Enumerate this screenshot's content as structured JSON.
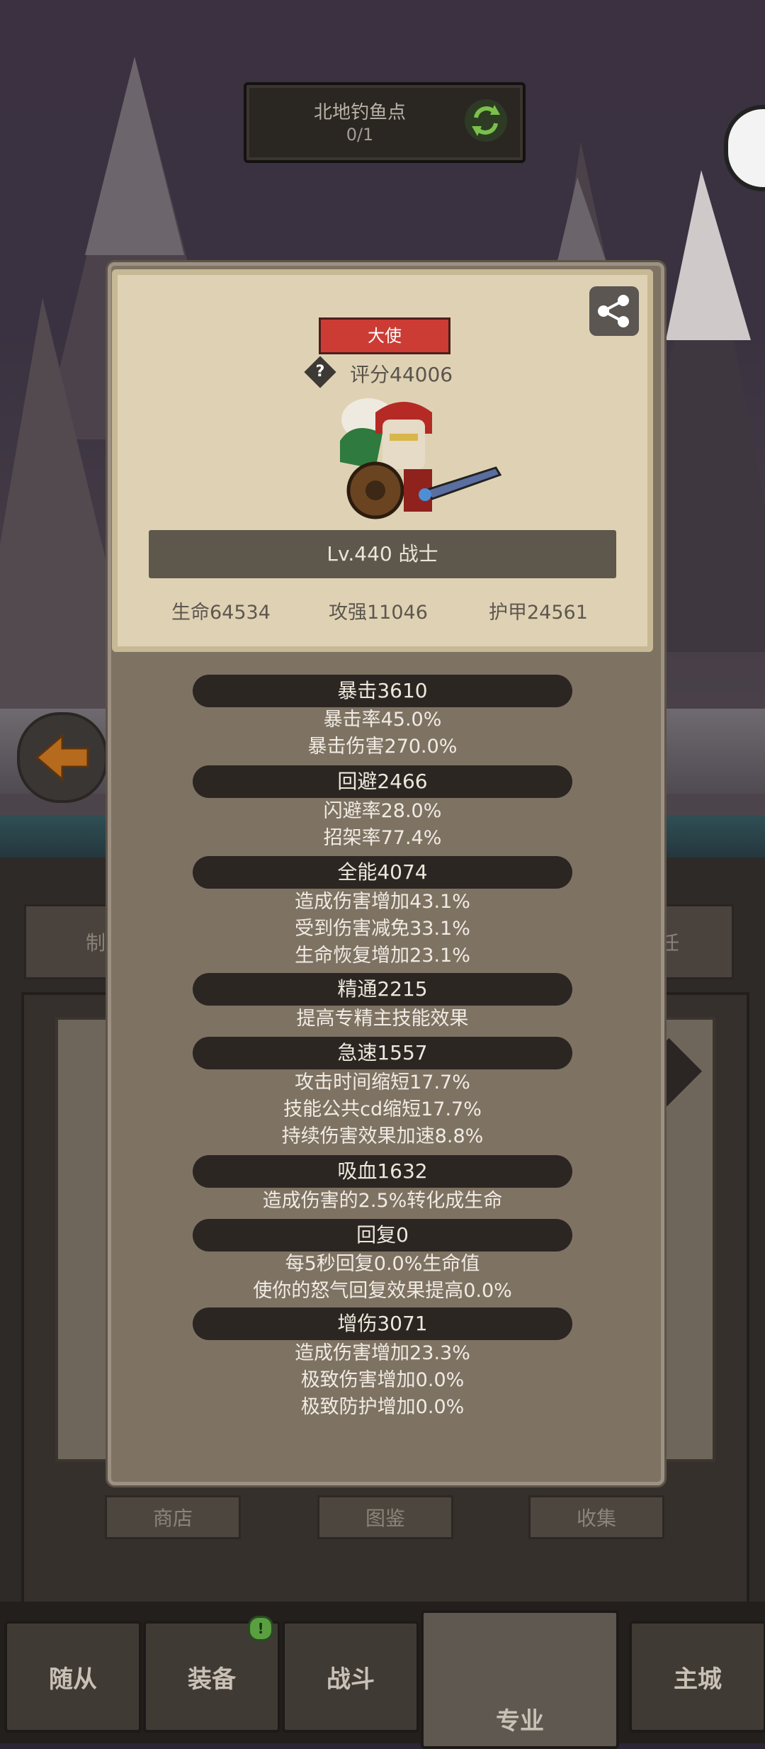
{
  "location": {
    "name": "北地钓鱼点",
    "count": "0/1"
  },
  "character": {
    "rank": "大使",
    "score": "评分44006",
    "level": "Lv.440 战士",
    "base_stats": [
      "生命64534",
      "攻强11046",
      "护甲24561"
    ]
  },
  "stats": [
    {
      "title": "暴击3610",
      "details": [
        "暴击率45.0%",
        "暴击伤害270.0%"
      ]
    },
    {
      "title": "回避2466",
      "details": [
        "闪避率28.0%",
        "招架率77.4%"
      ]
    },
    {
      "title": "全能4074",
      "details": [
        "造成伤害增加43.1%",
        "受到伤害减免33.1%",
        "生命恢复增加23.1%"
      ]
    },
    {
      "title": "精通2215",
      "details": [
        "提高专精主技能效果"
      ]
    },
    {
      "title": "急速1557",
      "details": [
        "攻击时间缩短17.7%",
        "技能公共cd缩短17.7%",
        "持续伤害效果加速8.8%"
      ]
    },
    {
      "title": "吸血1632",
      "details": [
        "造成伤害的2.5%转化成生命"
      ]
    },
    {
      "title": "回复0",
      "details": [
        "每5秒回复0.0%生命值",
        "使你的怒气回复效果提高0.0%"
      ]
    },
    {
      "title": "增伤3071",
      "details": [
        "造成伤害增加23.3%",
        "极致伤害增加0.0%",
        "极致防护增加0.0%"
      ]
    }
  ],
  "background_tabs": {
    "left_partial": "制",
    "right_partial": "任"
  },
  "sub_buttons": [
    "商店",
    "图鉴",
    "收集"
  ],
  "nav": {
    "items": [
      "随从",
      "装备",
      "战斗",
      "专业",
      "主城"
    ],
    "active": "专业",
    "badge": "!"
  },
  "colors": {
    "rank_badge": "#cc3c34",
    "card_bg": "#dfd2b4",
    "panel_bg": "#7e7263",
    "stat_pill": "#2b2622"
  },
  "icons": [
    "refresh-icon",
    "share-icon",
    "question-icon",
    "back-arrow-icon",
    "hero-sprite"
  ]
}
